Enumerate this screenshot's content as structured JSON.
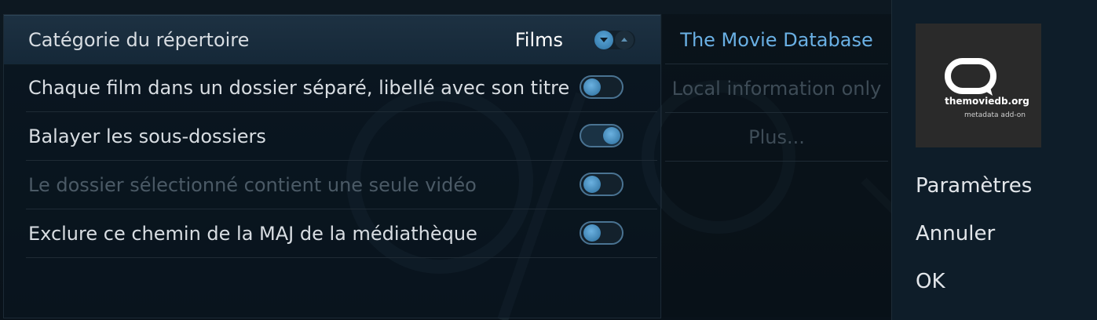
{
  "settings": {
    "rows": [
      {
        "label": "Catégorie du répertoire",
        "value": "Films",
        "control": "spinner",
        "focused": true,
        "enabled": true
      },
      {
        "label": "Chaque film dans un dossier séparé, libellé avec son titre",
        "control": "toggle",
        "state": "off",
        "enabled": true
      },
      {
        "label": "Balayer les sous-dossiers",
        "control": "toggle",
        "state": "on",
        "enabled": true
      },
      {
        "label": "Le dossier sélectionné contient une seule vidéo",
        "control": "toggle",
        "state": "off",
        "enabled": false
      },
      {
        "label": "Exclure ce chemin de la MAJ de la médiathèque",
        "control": "toggle",
        "state": "off",
        "enabled": true
      }
    ]
  },
  "scrapers": {
    "items": [
      {
        "label": "The Movie Database",
        "selected": true
      },
      {
        "label": "Local information only",
        "selected": false
      },
      {
        "label": "Plus...",
        "selected": false
      }
    ]
  },
  "addon_logo": {
    "brand": "themoviedb.org",
    "subtitle": "metadata add-on",
    "icon": "speech-bubble-icon"
  },
  "actions": {
    "settings_label": "Paramètres",
    "cancel_label": "Annuler",
    "ok_label": "OK"
  },
  "colors": {
    "accent": "#6ab0e4",
    "text": "#d8dde2",
    "disabled_text": "#4b5a66",
    "toggle_knob": "#4f97c8"
  }
}
